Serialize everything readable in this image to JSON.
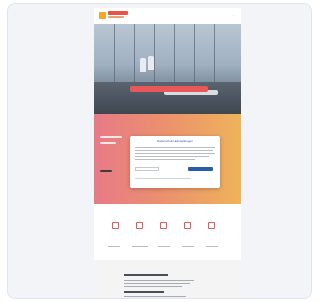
{
  "dialog": {
    "title": "Datenschutz-Einstellungen"
  },
  "colors": {
    "accent": "#e8575a",
    "brand": "#f5a623",
    "dialog_button": "#2a5fa8"
  },
  "icons": {
    "logo": "sunburst-logo-icon",
    "features": [
      "home-icon",
      "document-icon",
      "chart-icon",
      "calendar-icon",
      "grid-icon"
    ]
  }
}
